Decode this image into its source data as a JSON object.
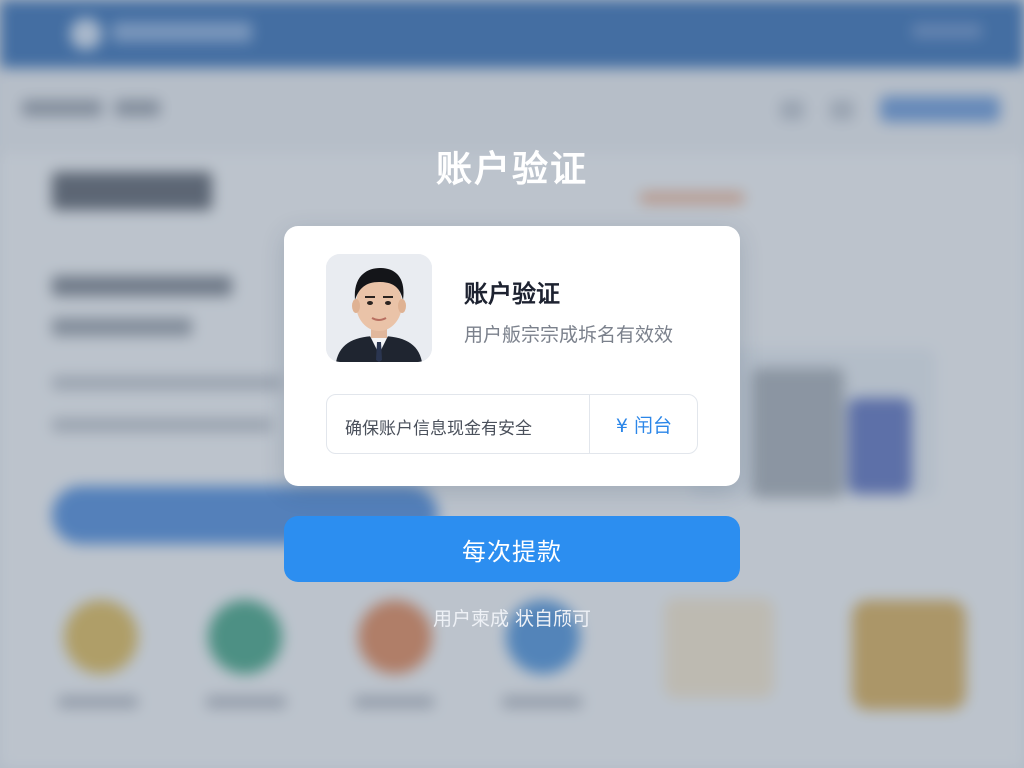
{
  "dialog": {
    "title": "账户验证",
    "card": {
      "avatar_icon": "person-photo",
      "title": "账户验证",
      "subtitle": "用户舨宗宗成坼名有效效",
      "info_text": "确保账户信息现金有安全",
      "action_label": "¥ 闬台"
    },
    "primary_button_label": "每次提款",
    "footer_link_label": "用户柬成 状自颀可"
  },
  "colors": {
    "primary": "#2c8ef0",
    "header_bg": "#1f5fae",
    "overlay": "#788291"
  }
}
